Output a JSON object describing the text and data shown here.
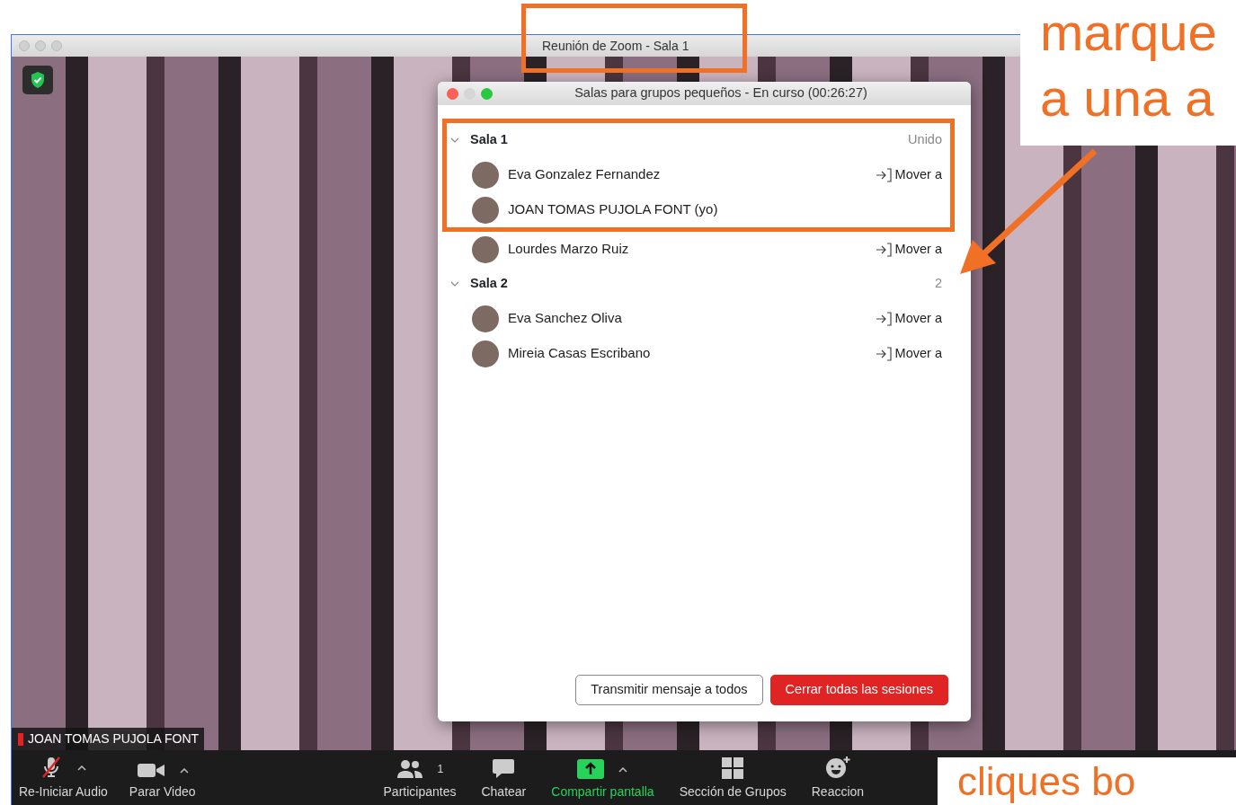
{
  "window": {
    "title": "Reunión de Zoom - Sala 1"
  },
  "video": {
    "participant_name": "JOAN TOMAS PUJOLA FONT"
  },
  "dialog": {
    "title": "Salas para grupos pequeños - En curso (00:26:27)",
    "rooms": [
      {
        "name": "Sala 1",
        "status": "Unido",
        "expanded": true,
        "participants": [
          {
            "name": "Eva Gonzalez Fernandez",
            "action": "Mover a"
          },
          {
            "name": "JOAN TOMAS PUJOLA FONT (yo)"
          },
          {
            "name": "Lourdes Marzo Ruiz",
            "action": "Mover a"
          }
        ]
      },
      {
        "name": "Sala 2",
        "status": "2",
        "expanded": true,
        "participants": [
          {
            "name": "Eva Sanchez Oliva",
            "action": "Mover a"
          },
          {
            "name": "Mireia Casas Escribano",
            "action": "Mover a"
          }
        ]
      }
    ],
    "buttons": [
      {
        "label": "Transmitir mensaje a todos",
        "kind": "secondary"
      },
      {
        "label": "Cerrar todas las sesiones",
        "kind": "danger"
      }
    ]
  },
  "toolbar": {
    "items": [
      {
        "label": "Re-Iniciar Audio",
        "kind": "mic-muted",
        "caret": true
      },
      {
        "label": "Parar Video",
        "kind": "camera",
        "caret": true
      },
      {
        "label": "Participantes",
        "kind": "people",
        "count": "1"
      },
      {
        "label": "Chatear",
        "kind": "chat"
      },
      {
        "label": "Compartir pantalla",
        "kind": "share",
        "caret": true
      },
      {
        "label": "Sección de Grupos",
        "kind": "grid"
      },
      {
        "label": "Reaccion",
        "kind": "reaction"
      }
    ]
  },
  "callouts": [
    {
      "text": "marque"
    },
    {
      "text": "a una a"
    },
    {
      "text": "cliques bo"
    }
  ]
}
